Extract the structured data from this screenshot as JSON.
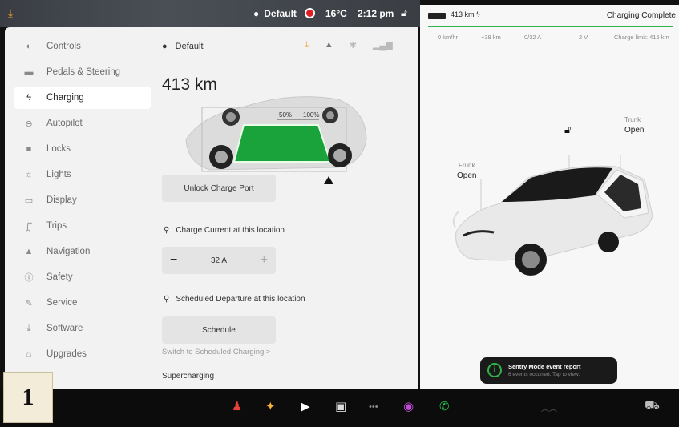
{
  "topbar": {
    "profile_name": "Default",
    "temperature": "16°C",
    "time": "2:12 pm"
  },
  "sidebar": {
    "items": [
      {
        "label": "Controls",
        "icon": "toggle-icon"
      },
      {
        "label": "Pedals & Steering",
        "icon": "car-icon"
      },
      {
        "label": "Charging",
        "icon": "bolt-icon",
        "active": true
      },
      {
        "label": "Autopilot",
        "icon": "steering-wheel-icon"
      },
      {
        "label": "Locks",
        "icon": "lock-icon"
      },
      {
        "label": "Lights",
        "icon": "sun-icon"
      },
      {
        "label": "Display",
        "icon": "display-icon"
      },
      {
        "label": "Trips",
        "icon": "trips-icon"
      },
      {
        "label": "Navigation",
        "icon": "navigation-arrow-icon"
      },
      {
        "label": "Safety",
        "icon": "info-icon"
      },
      {
        "label": "Service",
        "icon": "wrench-icon"
      },
      {
        "label": "Software",
        "icon": "download-icon"
      },
      {
        "label": "Upgrades",
        "icon": "bag-icon"
      }
    ]
  },
  "content": {
    "profile_name": "Default",
    "range": "413 km",
    "charge_limit_marks": [
      "50%",
      "100%"
    ],
    "unlock_port_label": "Unlock Charge Port",
    "charge_current_title": "Charge Current at this location",
    "charge_current_value": "32 A",
    "scheduled_departure_title": "Scheduled Departure at this location",
    "schedule_label": "Schedule",
    "switch_link": "Switch to Scheduled Charging >",
    "supercharging_label": "Supercharging"
  },
  "right_panel": {
    "range": "413 km",
    "status": "Charging Complete",
    "stats": {
      "speed": "0 km/hr",
      "added": "+38 km",
      "current": "0/32 A",
      "voltage": "2 V",
      "charge_limit": "Charge limit: 415 km"
    },
    "frunk_label": "Frunk",
    "frunk_state": "Open",
    "trunk_label": "Trunk",
    "trunk_state": "Open",
    "accent_green": "#2fb54a"
  },
  "toast": {
    "title": "Sentry Mode event report",
    "subtitle": "6 events occurred. Tap to view."
  },
  "badge_number": "1"
}
